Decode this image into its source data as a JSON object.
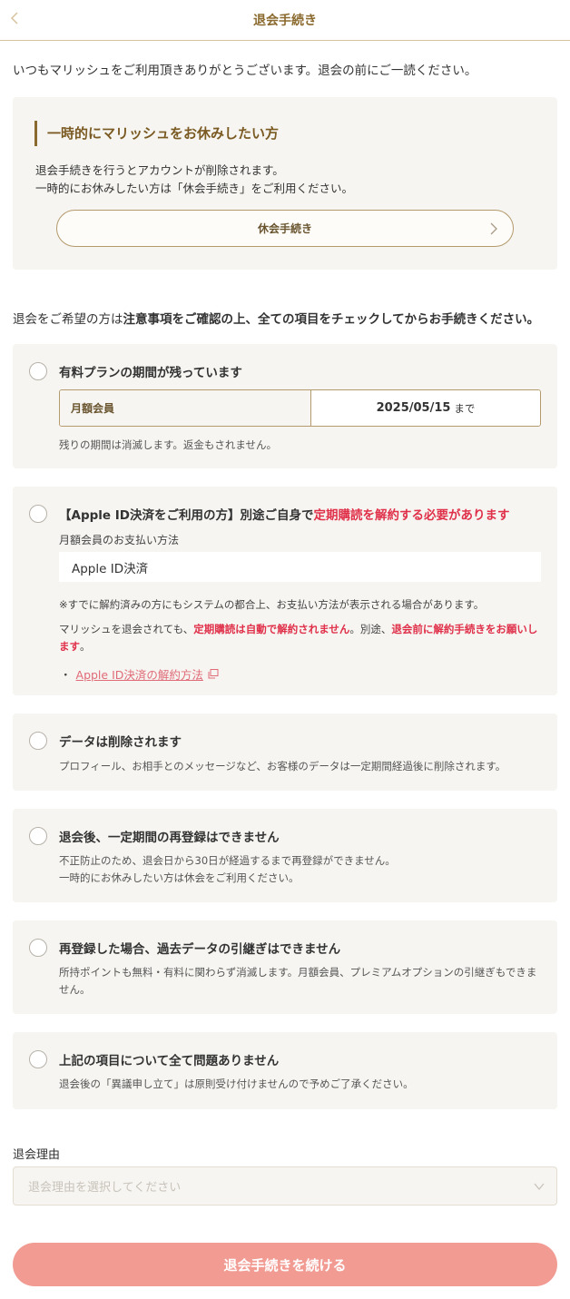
{
  "header": {
    "title": "退会手続き",
    "back_icon": "chevron-left-icon"
  },
  "intro": "いつもマリッシュをご利用頂きありがとうございます。退会の前にご一読ください。",
  "pause_section": {
    "heading": "一時的にマリッシュをお休みしたい方",
    "line1": "退会手続きを行うとアカウントが削除されます。",
    "line2": "一時的にお休みしたい方は「休会手続き」をご利用ください。",
    "button_label": "休会手続き"
  },
  "notice": {
    "part1": "退会をご希望の方は",
    "part2_bold": "注意事項をご確認の上、全ての項目をチェックしてからお手続きください。"
  },
  "checklist": [
    {
      "title": "有料プランの期間が残っています",
      "plan_label": "月額会員",
      "plan_date": "2025/05/15",
      "plan_suffix": "まで",
      "description": "残りの期間は消滅します。返金もされません。"
    },
    {
      "title_part1": "【Apple ID決済をご利用の方】別途ご自身で",
      "title_part2_red": "定期購読を解約する必要があります",
      "payment_label": "月額会員のお支払い方法",
      "payment_method": "Apple ID決済",
      "note1": "※すでに解約済みの方にもシステムの都合上、お支払い方法が表示される場合があります。",
      "note2_part1": "マリッシュを退会されても、",
      "note2_part2_red": "定期購読は自動で解約されません",
      "note2_part3": "。別途、",
      "note2_part4_red": "退会前に解約手続きをお願いします",
      "note2_part5": "。",
      "link_bullet": "・",
      "link_text": "Apple ID決済の解約方法"
    },
    {
      "title": "データは削除されます",
      "description": "プロフィール、お相手とのメッセージなど、お客様のデータは一定期間経過後に削除されます。"
    },
    {
      "title": "退会後、一定期間の再登録はできません",
      "description_line1": "不正防止のため、退会日から30日が経過するまで再登録ができません。",
      "description_line2": "一時的にお休みしたい方は休会をご利用ください。"
    },
    {
      "title": "再登録した場合、過去データの引継ぎはできません",
      "description": "所持ポイントも無料・有料に関わらず消滅します。月額会員、プレミアムオプションの引継ぎもできません。"
    },
    {
      "title": "上記の項目について全て問題ありません",
      "description": "退会後の「異議申し立て」は原則受け付けませんので予めご了承ください。"
    }
  ],
  "reason": {
    "label": "退会理由",
    "placeholder": "退会理由を選択してください"
  },
  "submit_label": "退会手続きを続ける",
  "colors": {
    "accent_brown": "#8a6a2e",
    "warning_red": "#e0304a",
    "link_pink": "#e06b78",
    "submit_bg": "#f19b93",
    "box_bg": "#f6f5f1"
  }
}
